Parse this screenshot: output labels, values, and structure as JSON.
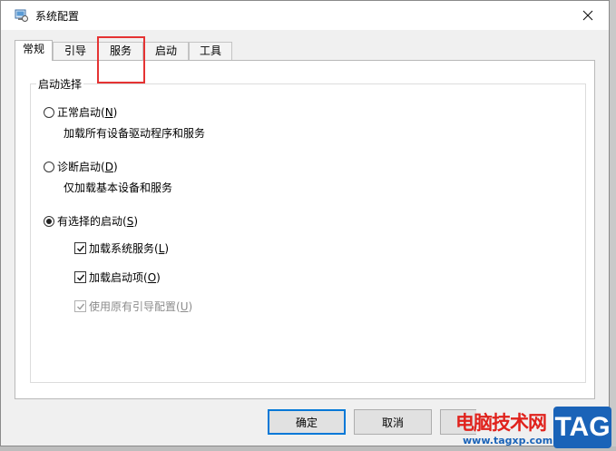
{
  "window": {
    "title": "系统配置"
  },
  "tabs": [
    {
      "label": "常规",
      "active": true
    },
    {
      "label": "引导",
      "active": false
    },
    {
      "label": "服务",
      "active": false
    },
    {
      "label": "启动",
      "active": false
    },
    {
      "label": "工具",
      "active": false
    }
  ],
  "startup_group": {
    "legend": "启动选择",
    "normal": {
      "label_text": "正常启动(",
      "hotkey": "N",
      "label_end": ")",
      "desc": "加载所有设备驱动程序和服务",
      "selected": false
    },
    "diagnostic": {
      "label_text": "诊断启动(",
      "hotkey": "D",
      "label_end": ")",
      "desc": "仅加载基本设备和服务",
      "selected": false
    },
    "selective": {
      "label_text": "有选择的启动(",
      "hotkey": "S",
      "label_end": ")",
      "selected": true
    },
    "options": [
      {
        "label_text": "加载系统服务(",
        "hotkey": "L",
        "label_end": ")",
        "checked": true,
        "enabled": true
      },
      {
        "label_text": "加载启动项(",
        "hotkey": "O",
        "label_end": ")",
        "checked": true,
        "enabled": true
      },
      {
        "label_text": "使用原有引导配置(",
        "hotkey": "U",
        "label_end": ")",
        "checked": true,
        "enabled": false
      }
    ]
  },
  "buttons": {
    "ok": "确定",
    "cancel": "取消"
  },
  "watermark": {
    "site_name": "电脑技术网",
    "url": "www.tagxp.com",
    "badge": "TAG"
  },
  "colors": {
    "accent": "#0078d7",
    "highlight_box": "#e53333",
    "watermark_red": "#e0221c",
    "watermark_blue": "#1a63b8"
  }
}
